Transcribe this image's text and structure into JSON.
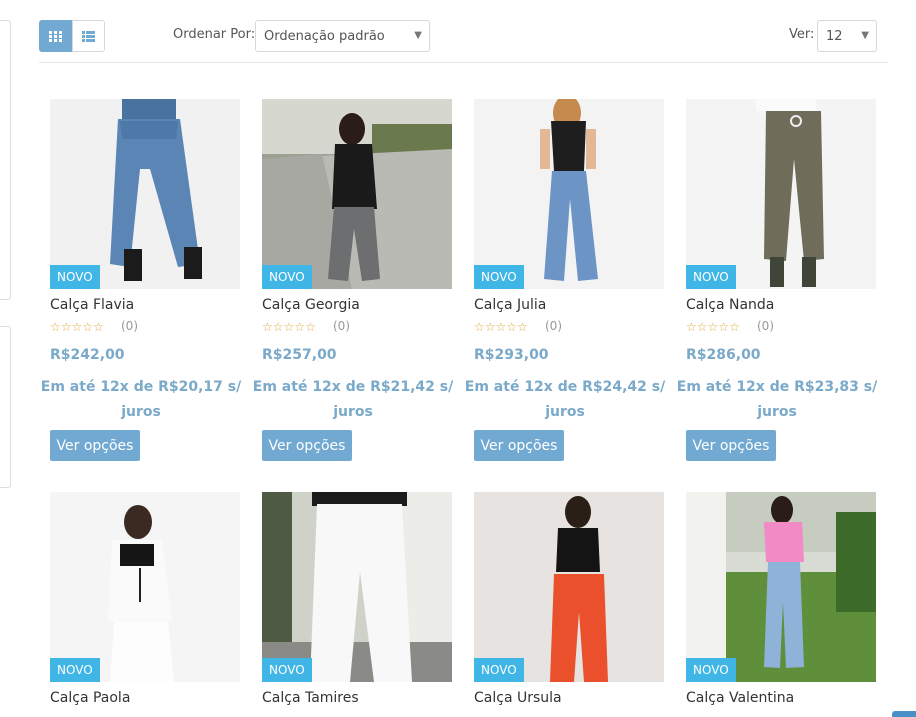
{
  "toolbar": {
    "sort_label": "Ordenar Por:",
    "sort_value": "Ordenação padrão",
    "show_label": "Ver:",
    "show_value": "12",
    "grid_icon": "grid-icon",
    "list_icon": "list-icon",
    "dropdown_icon": "chevron-down-icon"
  },
  "colors": {
    "accent": "#72a9d3",
    "badge": "#3fb6e6",
    "price": "#7aa9c9",
    "stars": "#e0a63a"
  },
  "products": [
    {
      "badge": "NOVO",
      "name": "Calça Flavia",
      "stars": "☆☆☆☆☆",
      "reviews": "(0)",
      "price": "R$242,00",
      "installments": "Em até 12x de R$20,17 s/ juros",
      "button": "Ver opções",
      "image": "woman in wide-leg blue jeans"
    },
    {
      "badge": "NOVO",
      "name": "Calça Georgia",
      "stars": "☆☆☆☆☆",
      "reviews": "(0)",
      "price": "R$257,00",
      "installments": "Em até 12x de R$21,42 s/ juros",
      "button": "Ver opções",
      "image": "woman in grey flared pants outdoors"
    },
    {
      "badge": "NOVO",
      "name": "Calça Julia",
      "stars": "☆☆☆☆☆",
      "reviews": "(0)",
      "price": "R$293,00",
      "installments": "Em até 12x de R$24,42 s/ juros",
      "button": "Ver opções",
      "image": "woman in straight light-blue jeans"
    },
    {
      "badge": "NOVO",
      "name": "Calça Nanda",
      "stars": "☆☆☆☆☆",
      "reviews": "(0)",
      "price": "R$286,00",
      "installments": "Em até 12x de R$23,83 s/ juros",
      "button": "Ver opções",
      "image": "olive jogger pants with drawstring"
    },
    {
      "badge": "NOVO",
      "name": "Calça Paola",
      "image": "woman in white pants and black top"
    },
    {
      "badge": "NOVO",
      "name": "Calça Tamires",
      "image": "white wide-leg jeans"
    },
    {
      "badge": "NOVO",
      "name": "Calça Ursula",
      "image": "woman in orange pants"
    },
    {
      "badge": "NOVO",
      "name": "Calça Valentina",
      "image": "woman in pink top and jeans in garden"
    }
  ]
}
